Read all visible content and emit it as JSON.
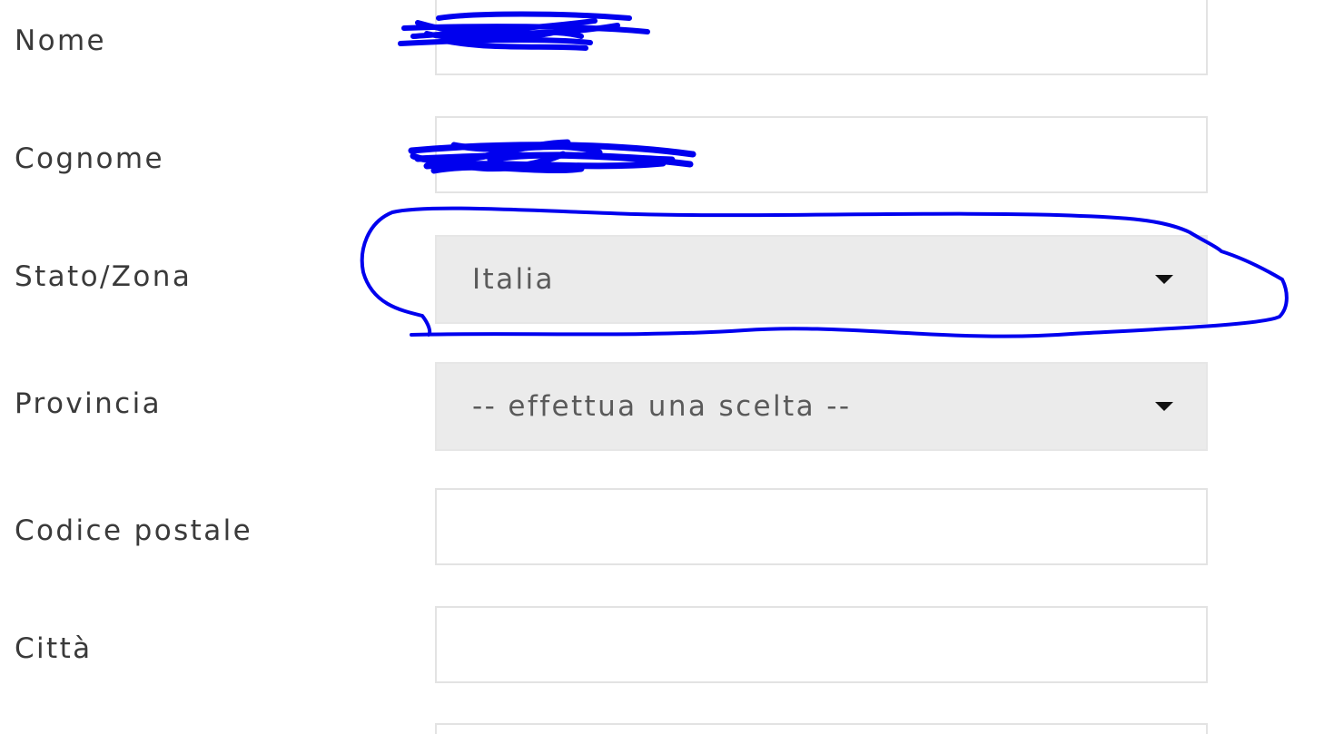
{
  "fields": {
    "nome": {
      "label": "Nome",
      "value": ""
    },
    "cognome": {
      "label": "Cognome",
      "value": ""
    },
    "stato": {
      "label": "Stato/Zona",
      "selected": "Italia"
    },
    "provincia": {
      "label": "Provincia",
      "selected": "-- effettua una scelta --"
    },
    "codice_postale": {
      "label": "Codice postale",
      "value": ""
    },
    "citta": {
      "label": "Città",
      "value": ""
    }
  },
  "icons": {
    "select_caret": "caret-down-icon"
  },
  "colors": {
    "annotation_ink": "#0000ee",
    "select_background": "#ebebeb",
    "field_border": "#e3e3e3",
    "label_text": "#3a3a3a"
  }
}
